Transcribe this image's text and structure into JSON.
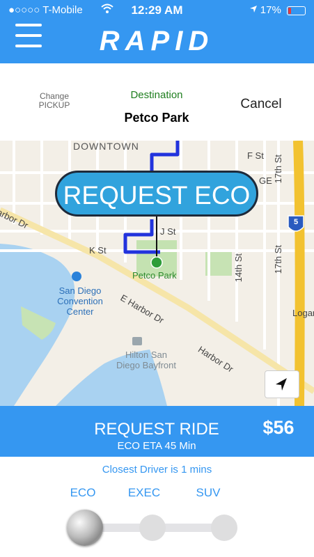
{
  "status_bar": {
    "carrier": "●○○○○ T-Mobile",
    "time": "12:29 AM",
    "battery": "17%"
  },
  "header": {
    "logo": "RAPID"
  },
  "destination_panel": {
    "change_pickup_line1": "Change",
    "change_pickup_line2": "PICKUP",
    "destination_label": "Destination",
    "destination_name": "Petco Park",
    "cancel_label": "Cancel"
  },
  "map": {
    "labels": {
      "downtown": "DOWNTOWN",
      "f_st": "F St",
      "st_17_a": "17th St",
      "st_17_b": "17th St",
      "st_14": "14th St",
      "k_st": "K St",
      "j_st": "J St",
      "harbor_dr_w": "arbor Dr",
      "e_harbor_dr": "E Harbor Dr",
      "harbor_dr_e": "Harbor Dr",
      "petco_park": "Petco Park",
      "convention_1": "San Diego",
      "convention_2": "Convention",
      "convention_3": "Center",
      "hilton_1": "Hilton San",
      "hilton_2": "Diego Bayfront",
      "logan": "Logan",
      "ge": "GE",
      "interstate": "5"
    }
  },
  "request_bubble": {
    "label": "REQUEST ECO"
  },
  "ride_panel": {
    "request_label": "REQUEST RIDE",
    "eta_label": "ECO ETA 45 Min",
    "price": "$56",
    "closest_driver": "Closest Driver is 1 mins",
    "classes": [
      "ECO",
      "EXEC",
      "SUV"
    ]
  },
  "colors": {
    "accent": "#3597f1",
    "bubble": "#31a3dd",
    "route": "#2233dd",
    "destination_green": "#1e7e1e"
  }
}
